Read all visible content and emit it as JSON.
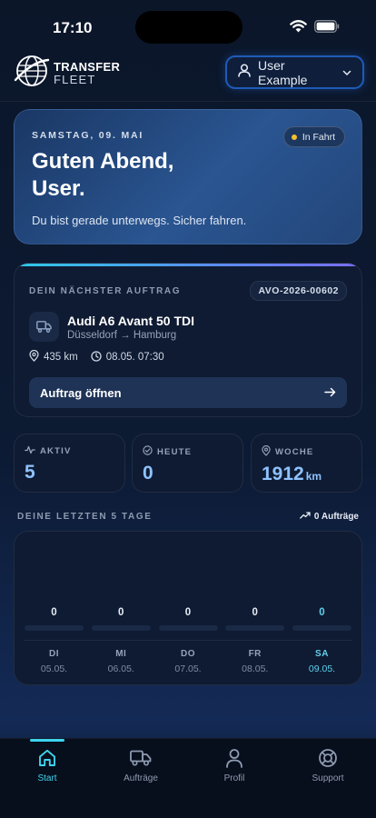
{
  "status_bar": {
    "time": "17:10"
  },
  "header": {
    "logo_line1": "TRANSFER",
    "logo_line2": "FLEET",
    "user_label": "User Example"
  },
  "greeting": {
    "date": "SAMSTAG, 09. MAI",
    "badge": "In Fahrt",
    "title": "Guten Abend, User.",
    "subtitle": "Du bist gerade unterwegs. Sicher fahren."
  },
  "next_order": {
    "label": "DEIN NÄCHSTER AUFTRAG",
    "id": "AVO-2026-00602",
    "vehicle": "Audi A6 Avant 50 TDI",
    "route": "Düsseldorf → Hamburg",
    "distance": "435 km",
    "datetime": "08.05. 07:30",
    "button_label": "Auftrag öffnen"
  },
  "stats": [
    {
      "label": "AKTIV",
      "value": "5",
      "unit": "",
      "icon": "activity-icon"
    },
    {
      "label": "HEUTE",
      "value": "0",
      "unit": "",
      "icon": "check-circle-icon"
    },
    {
      "label": "WOCHE",
      "value": "1912",
      "unit": "km",
      "icon": "location-pin-icon"
    }
  ],
  "last_days": {
    "title": "DEINE LETZTEN 5 TAGE",
    "summary": "0 Aufträge",
    "days": [
      {
        "value": "0",
        "day": "DI",
        "date": "05.05."
      },
      {
        "value": "0",
        "day": "MI",
        "date": "06.05."
      },
      {
        "value": "0",
        "day": "DO",
        "date": "07.05."
      },
      {
        "value": "0",
        "day": "FR",
        "date": "08.05."
      },
      {
        "value": "0",
        "day": "SA",
        "date": "09.05."
      }
    ]
  },
  "tabs": [
    {
      "label": "Start",
      "icon": "home-icon"
    },
    {
      "label": "Aufträge",
      "icon": "truck-icon"
    },
    {
      "label": "Profil",
      "icon": "user-icon"
    },
    {
      "label": "Support",
      "icon": "lifebuoy-icon"
    }
  ],
  "colors": {
    "accent": "#3ed4ef",
    "value": "#8fc2ff",
    "badge_dot": "#f5c02e",
    "button_border": "#1e5bb8"
  }
}
